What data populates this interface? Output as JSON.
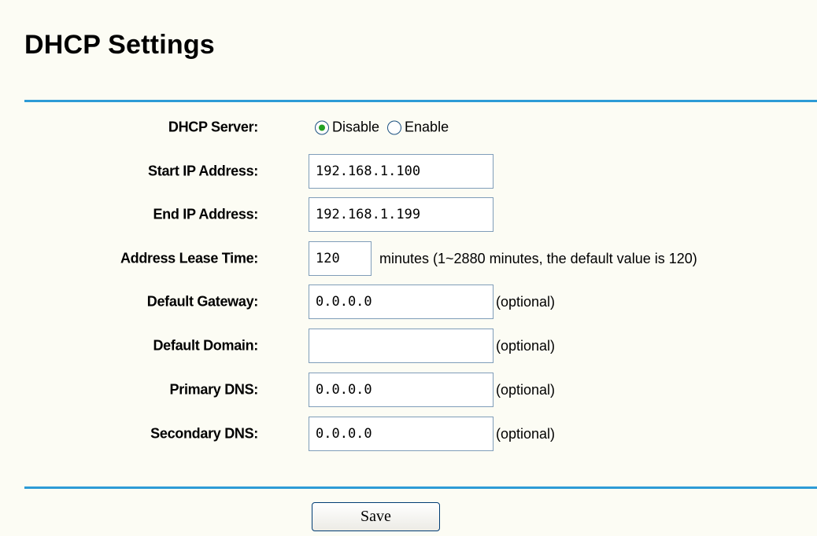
{
  "page": {
    "title": "DHCP Settings"
  },
  "dhcp_server": {
    "label": "DHCP Server:",
    "options": [
      {
        "label": "Disable",
        "selected": true
      },
      {
        "label": "Enable",
        "selected": false
      }
    ]
  },
  "fields": {
    "start_ip": {
      "label": "Start IP Address:",
      "value": "192.168.1.100"
    },
    "end_ip": {
      "label": "End IP Address:",
      "value": "192.168.1.199"
    },
    "lease_time": {
      "label": "Address Lease Time:",
      "value": "120",
      "hint": "minutes (1~2880 minutes, the default value is 120)"
    },
    "default_gateway": {
      "label": "Default Gateway:",
      "value": "0.0.0.0",
      "hint": "(optional)"
    },
    "default_domain": {
      "label": "Default Domain:",
      "value": "",
      "hint": "(optional)"
    },
    "primary_dns": {
      "label": "Primary DNS:",
      "value": "0.0.0.0",
      "hint": "(optional)"
    },
    "secondary_dns": {
      "label": "Secondary DNS:",
      "value": "0.0.0.0",
      "hint": "(optional)"
    }
  },
  "actions": {
    "save_label": "Save"
  },
  "colors": {
    "background": "#fcfcf4",
    "divider": "#2d9bd6",
    "radio_selected": "#21a121",
    "input_border": "#7f9db9"
  }
}
